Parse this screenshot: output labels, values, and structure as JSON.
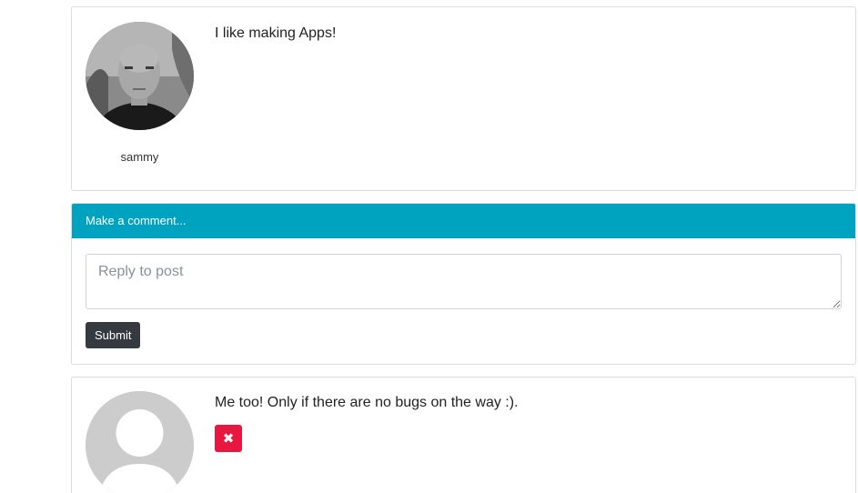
{
  "post": {
    "username": "sammy",
    "text": "I like making Apps!",
    "avatar_icon": "user-photo"
  },
  "comment_form": {
    "header": "Make a comment...",
    "placeholder": "Reply to post",
    "submit_label": "Submit"
  },
  "reply": {
    "text": "Me too! Only if there are no bugs on the way :).",
    "avatar_icon": "default-user-avatar",
    "delete_icon": "close-icon",
    "delete_glyph": "✖"
  },
  "colors": {
    "header_bg": "#00a3bf",
    "submit_bg": "#343a40",
    "delete_bg": "#e8173f",
    "card_border": "#dcdcdc"
  }
}
